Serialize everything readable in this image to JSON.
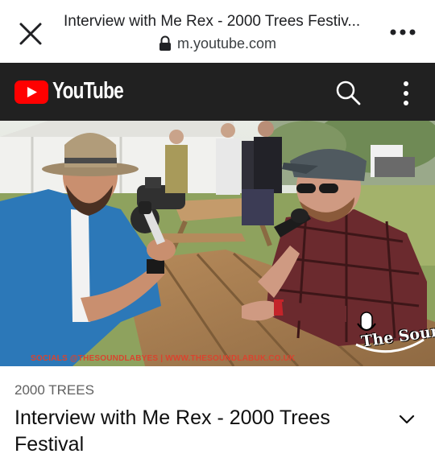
{
  "browser": {
    "page_title": "Interview with Me Rex - 2000 Trees Festiv...",
    "url": "m.youtube.com",
    "icons": [
      "close-icon",
      "lock-icon",
      "more-horizontal-icon"
    ]
  },
  "youtube_header": {
    "logo_text": "YouTube",
    "icons": [
      "youtube-play-icon",
      "search-icon",
      "more-vertical-icon"
    ],
    "colors": {
      "bar": "#212121",
      "logo_red": "#ff0000"
    }
  },
  "video": {
    "caption_overlay": "SOCIALS @THESOUNDLABYES | WWW.THESOUNDLABUK.CO.UK",
    "watermark": "The Sound"
  },
  "metadata": {
    "channel": "2000 TREES",
    "title": "Interview with Me Rex - 2000 Trees Festival",
    "expand_icon": "chevron-down-icon"
  }
}
